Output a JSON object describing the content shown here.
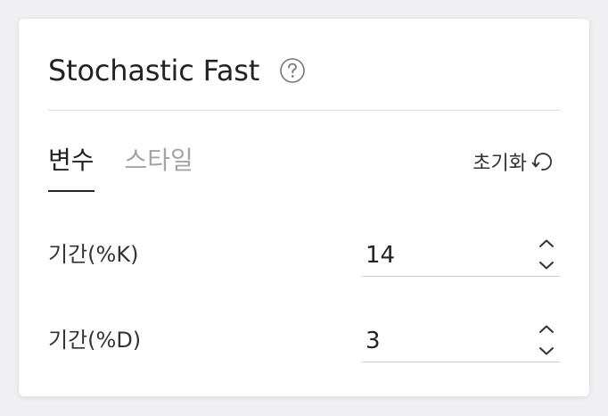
{
  "header": {
    "title": "Stochastic Fast",
    "help_icon": "question-circle-icon"
  },
  "tabs": [
    {
      "label": "변수",
      "active": true
    },
    {
      "label": "스타일",
      "active": false
    }
  ],
  "reset": {
    "label": "초기화",
    "icon": "rotate-ccw-icon"
  },
  "params": [
    {
      "label": "기간(%K)",
      "value": "14"
    },
    {
      "label": "기간(%D)",
      "value": "3"
    }
  ],
  "colors": {
    "text_primary": "#222222",
    "tab_inactive": "#a4a4a4",
    "divider": "#dcdcdc"
  }
}
